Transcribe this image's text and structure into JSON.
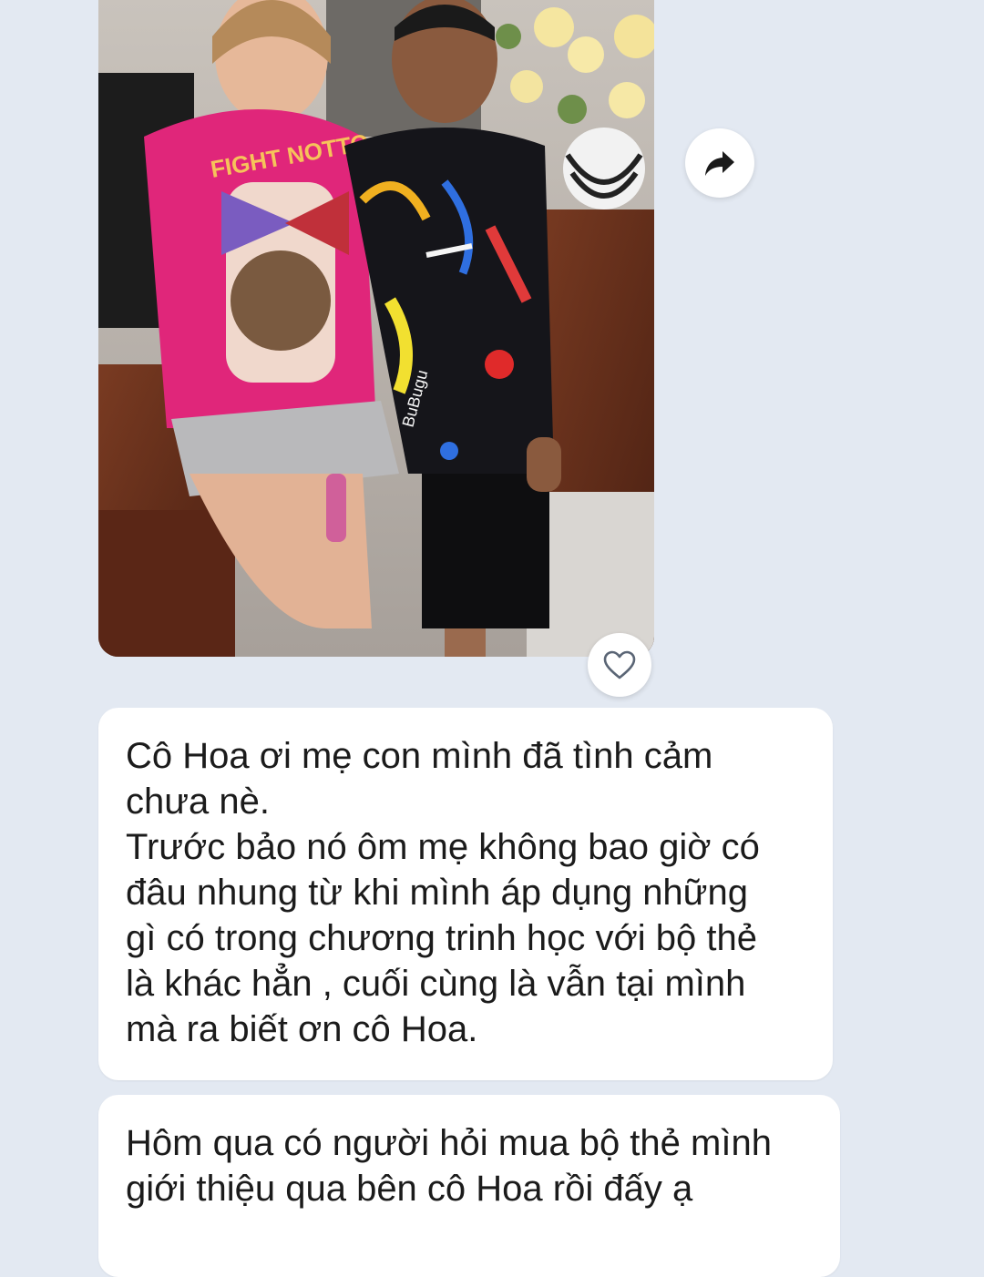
{
  "conversation": {
    "photo_message": {
      "image_alt": "Photo of a woman in a pink shirt hugging a boy in a black graphic shirt",
      "shirt_print_text": "FIGHT NOTTO",
      "boy_shirt_print_text": "BuBugu"
    },
    "actions": {
      "share_icon": "share-arrow-icon",
      "react_icon": "heart-outline-icon"
    },
    "messages": [
      {
        "lines": [
          "Cô Hoa ơi mẹ con mình đã tình cảm",
          "chưa nè.",
          "Trước bảo nó ôm mẹ không bao giờ có",
          "đâu nhung từ khi mình áp dụng những",
          "gì có trong chương trinh học với bộ thẻ",
          "là khác hẳn , cuối cùng là vẫn tại mình",
          "mà ra biết ơn cô Hoa."
        ]
      },
      {
        "lines": [
          "Hôm qua có người hỏi mua bộ thẻ mình",
          "giới thiệu qua bên cô Hoa rồi đấy ạ"
        ]
      }
    ]
  },
  "colors": {
    "background": "#e3e9f2",
    "bubble": "#ffffff",
    "text": "#1b1b1b"
  }
}
